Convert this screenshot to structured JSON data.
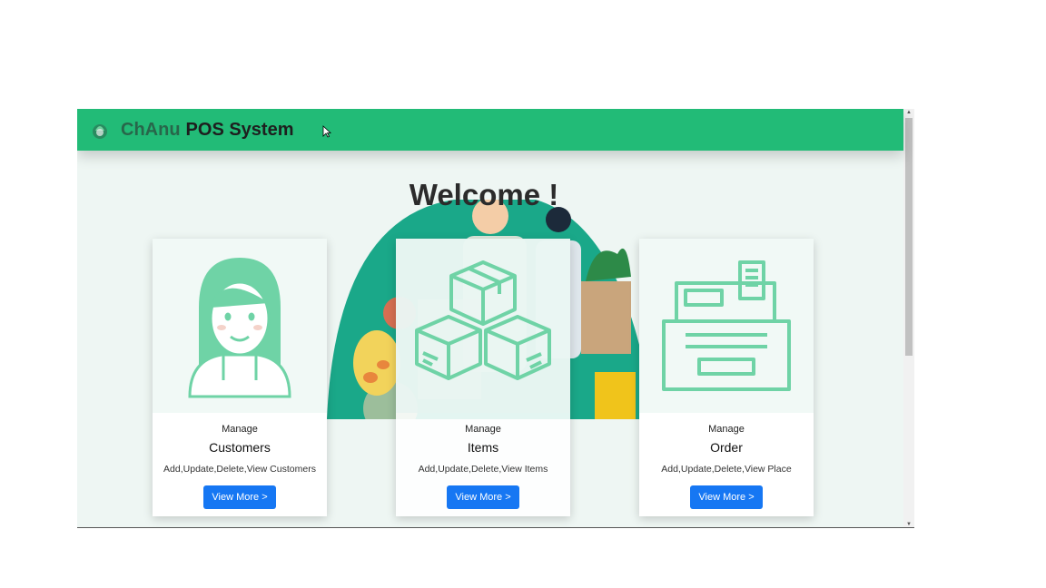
{
  "navbar": {
    "brand_first": "ChAnu",
    "brand_rest": "POS System",
    "color": "#22bb77"
  },
  "main": {
    "welcome": "Welcome !"
  },
  "cards": [
    {
      "subtitle": "Manage",
      "title": "Customers",
      "description": "Add,Update,Delete,View Customers",
      "button": "View More >",
      "icon": "customer-avatar-icon"
    },
    {
      "subtitle": "Manage",
      "title": "Items",
      "description": "Add,Update,Delete,View Items",
      "button": "View More >",
      "icon": "boxes-icon"
    },
    {
      "subtitle": "Manage",
      "title": "Order",
      "description": "Add,Update,Delete,View Place",
      "button": "View More >",
      "icon": "cash-register-icon"
    }
  ],
  "colors": {
    "accent": "#22bb77",
    "icon_green": "#6fd3a6",
    "button_blue": "#1677f3"
  }
}
